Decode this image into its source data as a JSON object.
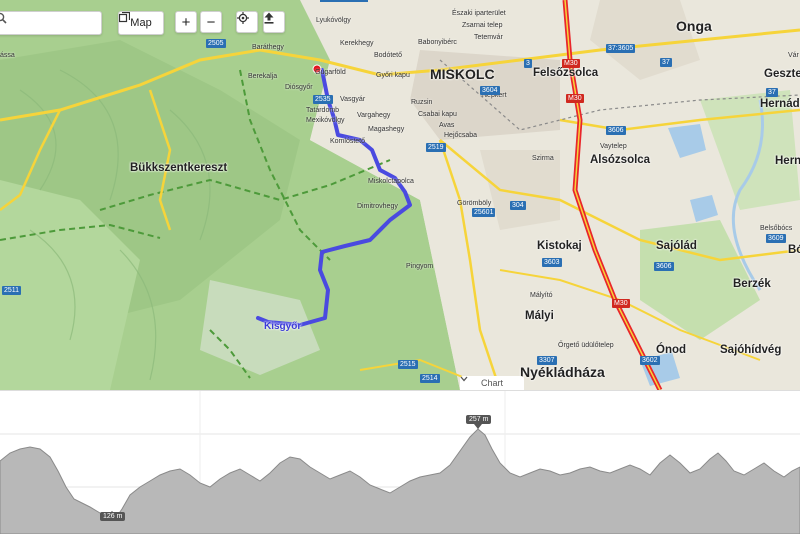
{
  "toolbar": {
    "layer_label": "Map",
    "zoom_in": "+",
    "zoom_out": "−"
  },
  "map": {
    "places": [
      {
        "id": "onga",
        "name": "Onga",
        "cls": "town-big"
      },
      {
        "id": "miskolc",
        "name": "MISKOLC",
        "cls": "town-big"
      },
      {
        "id": "felsozsolca",
        "name": "Felsőzsolca",
        "cls": "town"
      },
      {
        "id": "alsozsolca",
        "name": "Alsózsolca",
        "cls": "town"
      },
      {
        "id": "bukkszentkereszt",
        "name": "Bükkszentkereszt",
        "cls": "town"
      },
      {
        "id": "kistokaj",
        "name": "Kistokaj",
        "cls": "town"
      },
      {
        "id": "sajolad",
        "name": "Sajólád",
        "cls": "town"
      },
      {
        "id": "berzek",
        "name": "Berzék",
        "cls": "town"
      },
      {
        "id": "malyi",
        "name": "Mályi",
        "cls": "town"
      },
      {
        "id": "onod",
        "name": "Ónod",
        "cls": "town"
      },
      {
        "id": "sajohidveg",
        "name": "Sajóhídvég",
        "cls": "town"
      },
      {
        "id": "nyekladhaza",
        "name": "Nyékládháza",
        "cls": "town-big"
      },
      {
        "id": "hernad",
        "name": "Hernád",
        "cls": "town"
      },
      {
        "id": "gesztely",
        "name": "Geszte",
        "cls": "town"
      },
      {
        "id": "herna2",
        "name": "Herna",
        "cls": "town"
      },
      {
        "id": "bo",
        "name": "Bó",
        "cls": "town"
      }
    ],
    "small_labels": [
      "Lyukóvölgy",
      "Északi iparterület",
      "Kerekhegy",
      "Zsarnai telep",
      "Bodótető",
      "Babonyibérc",
      "Tetemvár",
      "Baráthegy",
      "Berekalja",
      "Diósgyőr",
      "Győri kapu",
      "Tatárdomb",
      "Vasgyár",
      "Mexikóvölgy",
      "Ruzsin",
      "Csabai kapu",
      "Vargahegy",
      "Avas",
      "Magashegy",
      "Komlóstető",
      "Hejőcsaba",
      "Szirma",
      "Vaytelep",
      "Miskolctapolca",
      "Dimitrovhegy",
      "Görömböly",
      "Pingyom",
      "Mályító",
      "Őrgető üdülőtelep",
      "Belsőbócs",
      "Népkert",
      "Gugarföld",
      "ássa",
      "Vár"
    ],
    "road_shields": [
      "2505",
      "2535",
      "2519",
      "3604",
      "3",
      "304",
      "25601",
      "3603",
      "3606",
      "3609",
      "3606",
      "3602",
      "3307",
      "2515",
      "2514",
      "2511",
      "37",
      "37",
      "37:3605"
    ],
    "motorway_shields": [
      "M30",
      "M30",
      "M30"
    ],
    "waypoint_label": "Kisgyőr",
    "chart_toggle_label": "Chart"
  },
  "elevation": {
    "max_label": "257 m",
    "min_label": "126 m"
  },
  "colors": {
    "route": "#4a4ae0",
    "forest": "#9fc98a",
    "urban": "#e3dfd5",
    "water": "#a8cbe8",
    "motorway": "#e9262b",
    "major_road": "#f6d43a",
    "trail": "#4d9a3a",
    "profile_fill": "#b8b8b8",
    "profile_line": "#8a8a8a"
  }
}
